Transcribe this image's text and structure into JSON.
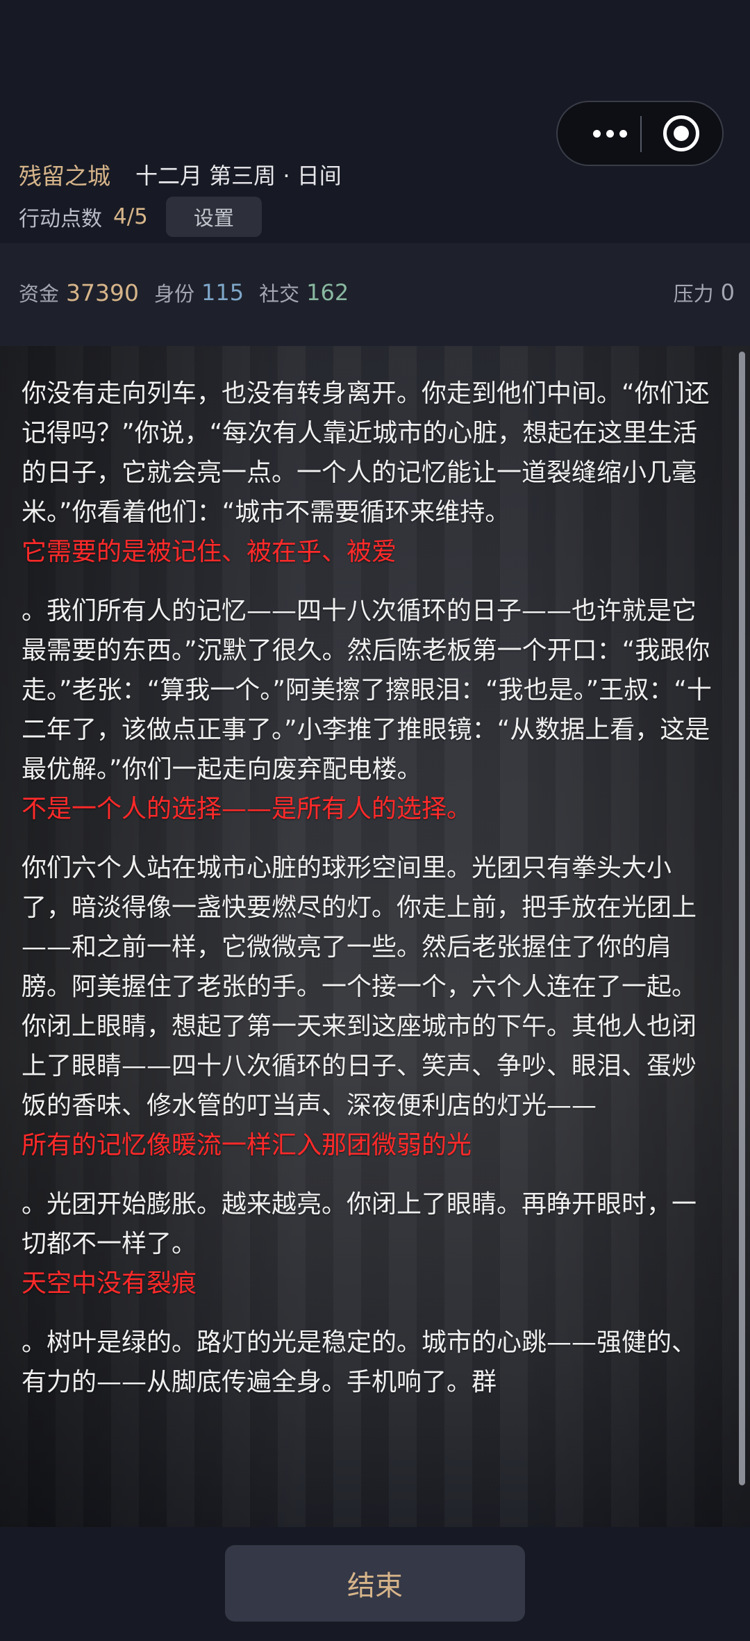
{
  "header": {
    "city": "残留之城",
    "date": "十二月 第三周 · 日间",
    "action_points_label": "行动点数",
    "action_points_value": "4/5",
    "settings_label": "设置"
  },
  "capsule": {
    "more_icon": "more-dots-icon",
    "close_icon": "target-circle-icon"
  },
  "stats": {
    "money_label": "资金",
    "money_value": "37390",
    "identity_label": "身份",
    "identity_value": "115",
    "social_label": "社交",
    "social_value": "162",
    "pressure_label": "压力",
    "pressure_value": "0"
  },
  "story": {
    "p1": "你没有走向列车，也没有转身离开。你走到他们中间。“你们还记得吗？”你说，“每次有人靠近城市的心脏，想起在这里生活的日子，它就会亮一点。一个人的记忆能让一道裂缝缩小几毫米。”你看着他们：“城市不需要循环来维持。",
    "h1": "它需要的是被记住、被在乎、被爱",
    "p2": "。我们所有人的记忆——四十八次循环的日子——也许就是它最需要的东西。”沉默了很久。然后陈老板第一个开口：“我跟你走。”老张：“算我一个。”阿美擦了擦眼泪：“我也是。”王叔：“十二年了，该做点正事了。”小李推了推眼镜：“从数据上看，这是最优解。”你们一起走向废弃配电楼。",
    "h2": "不是一个人的选择——是所有人的选择。",
    "p3": "你们六个人站在城市心脏的球形空间里。光团只有拳头大小了，暗淡得像一盏快要燃尽的灯。你走上前，把手放在光团上——和之前一样，它微微亮了一些。然后老张握住了你的肩膀。阿美握住了老张的手。一个接一个，六个人连在了一起。你闭上眼睛，想起了第一天来到这座城市的下午。其他人也闭上了眼睛——四十八次循环的日子、笑声、争吵、眼泪、蛋炒饭的香味、修水管的叮当声、深夜便利店的灯光——",
    "h3": "所有的记忆像暖流一样汇入那团微弱的光",
    "p4": "。光团开始膨胀。越来越亮。你闭上了眼睛。再睁开眼时，一切都不一样了。",
    "h4": "天空中没有裂痕",
    "p5": "。树叶是绿的。路灯的光是稳定的。城市的心跳——强健的、有力的——从脚底传遍全身。手机响了。群"
  },
  "footer": {
    "end_label": "结束"
  }
}
